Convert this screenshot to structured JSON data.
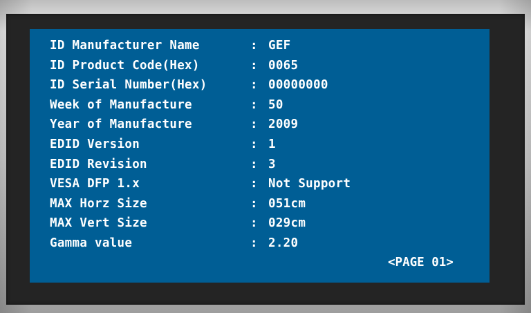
{
  "screen": {
    "rows": [
      {
        "label": "ID Manufacturer Name",
        "separator": ":",
        "value": "GEF"
      },
      {
        "label": "ID Product Code(Hex)",
        "separator": ":",
        "value": "0065"
      },
      {
        "label": "ID Serial Number(Hex)",
        "separator": ":",
        "value": "00000000"
      },
      {
        "label": "Week of Manufacture",
        "separator": ":",
        "value": "50"
      },
      {
        "label": "Year of Manufacture",
        "separator": ":",
        "value": "2009"
      },
      {
        "label": "EDID Version",
        "separator": ":",
        "value": "1"
      },
      {
        "label": "EDID Revision",
        "separator": ":",
        "value": "3"
      },
      {
        "label": "VESA DFP 1.x",
        "separator": ":",
        "value": "Not Support"
      },
      {
        "label": "MAX Horz Size",
        "separator": ":",
        "value": "051cm"
      },
      {
        "label": "MAX Vert Size",
        "separator": ":",
        "value": "029cm"
      },
      {
        "label": "Gamma value",
        "separator": ":",
        "value": "2.20"
      }
    ],
    "page_indicator": "<PAGE 01>"
  },
  "colors": {
    "screen_background": "#005e95",
    "text": "#ffffff",
    "frame": "#242424",
    "bezel": "#d6d6d6"
  }
}
